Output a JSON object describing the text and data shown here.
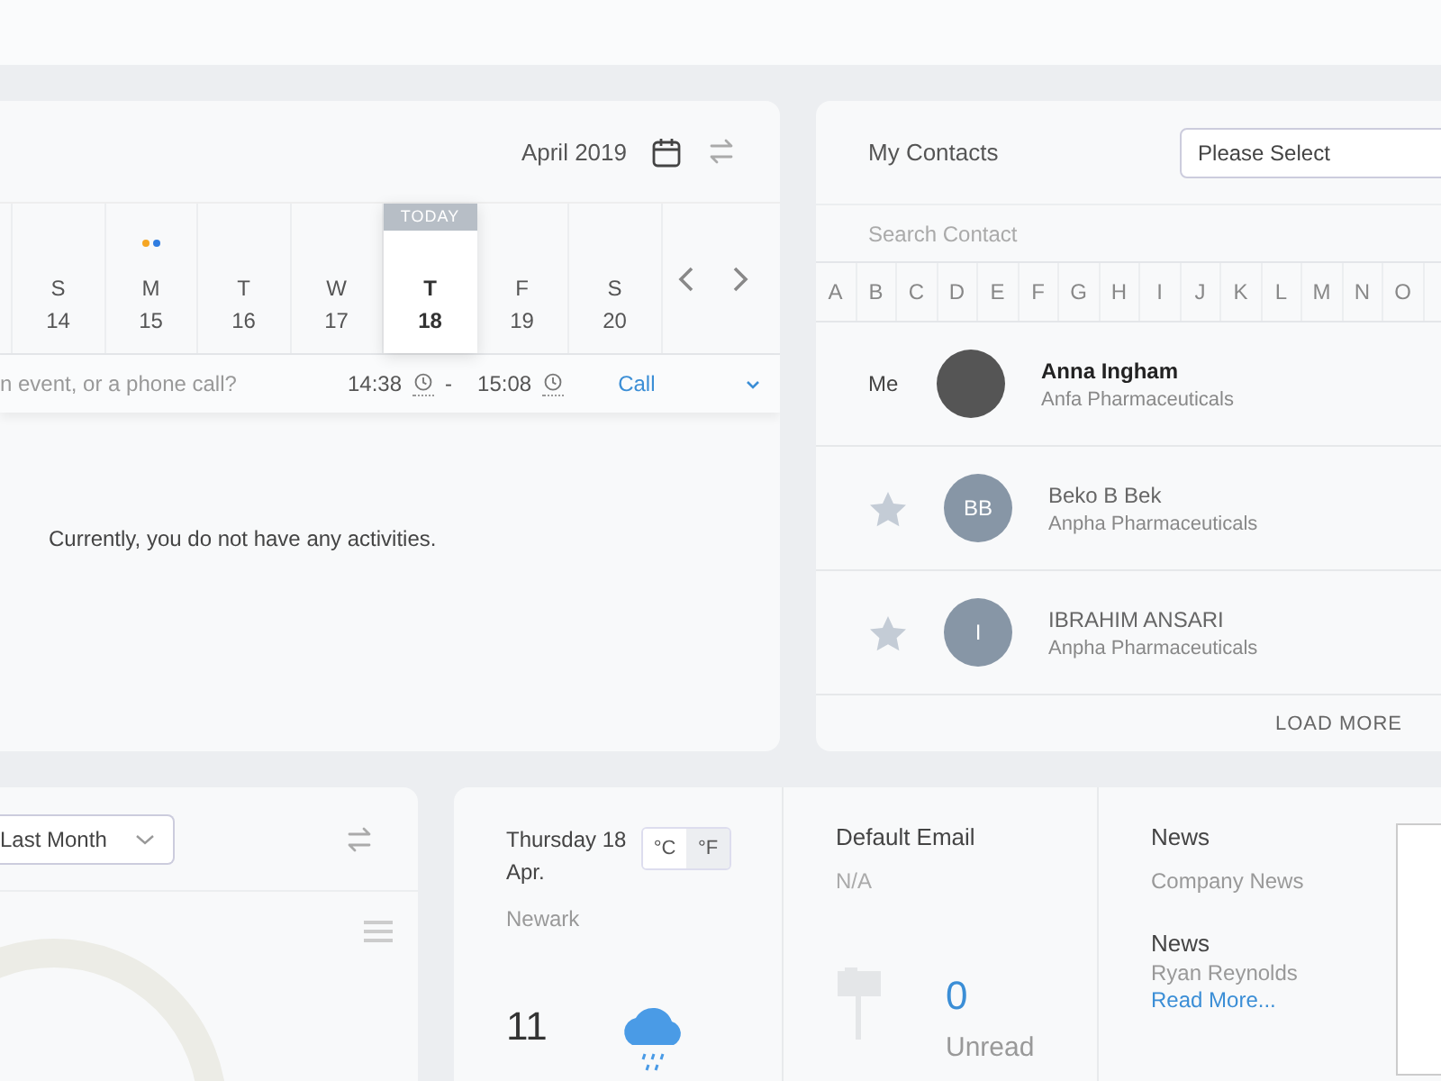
{
  "calendar": {
    "month": "April 2019",
    "today_label": "TODAY",
    "days": [
      {
        "weekday": "S",
        "date": "14",
        "selected": false
      },
      {
        "weekday": "M",
        "date": "15",
        "selected": false,
        "events": [
          {
            "color": "#f5a623"
          },
          {
            "color": "#2f7de1"
          }
        ]
      },
      {
        "weekday": "T",
        "date": "16",
        "selected": false
      },
      {
        "weekday": "W",
        "date": "17",
        "selected": false
      },
      {
        "weekday": "T",
        "date": "18",
        "selected": true
      },
      {
        "weekday": "F",
        "date": "19",
        "selected": false
      },
      {
        "weekday": "S",
        "date": "20",
        "selected": false
      }
    ],
    "quick_add": {
      "placeholder": "n event, or a phone call?",
      "start": "14:38",
      "separator": "-",
      "end": "15:08",
      "type": "Call"
    },
    "empty_message": "Currently, you do not have any activities."
  },
  "contacts": {
    "title": "My Contacts",
    "filter": {
      "value": "Please Select"
    },
    "search": {
      "placeholder": "Search Contact"
    },
    "letters": [
      "A",
      "B",
      "C",
      "D",
      "E",
      "F",
      "G",
      "H",
      "I",
      "J",
      "K",
      "L",
      "M",
      "N",
      "O"
    ],
    "people": [
      {
        "kind": "me",
        "label": "Me",
        "name": "Anna Ingham",
        "company": "Anfa Pharmaceuticals"
      },
      {
        "kind": "contact",
        "starred": false,
        "initials": "BB",
        "name": "Beko B Bek",
        "company": "Anpha Pharmaceuticals"
      },
      {
        "kind": "contact",
        "starred": false,
        "initials": "I",
        "name": "IBRAHIM ANSARI",
        "company": "Anpha Pharmaceuticals"
      }
    ],
    "load_more": "LOAD MORE"
  },
  "chart_card": {
    "period": "Last Month"
  },
  "weather": {
    "date": "Thursday 18 Apr.",
    "units": [
      {
        "label": "°C",
        "selected": false
      },
      {
        "label": "°F",
        "selected": true
      }
    ],
    "city": "Newark",
    "temperature": "11"
  },
  "email": {
    "title": "Default Email",
    "address": "N/A",
    "count": "0",
    "count_label": "Unread"
  },
  "news": [
    {
      "title": "News",
      "text": "Company News"
    },
    {
      "title": "News",
      "author": "Ryan Reynolds",
      "link": "Read More..."
    }
  ]
}
